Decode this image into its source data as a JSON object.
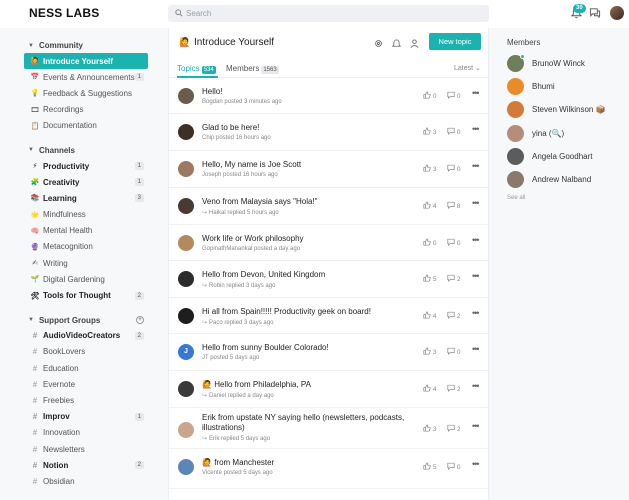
{
  "brand": "NESS LABS",
  "search": {
    "placeholder": "Search"
  },
  "header": {
    "notification_count": "30"
  },
  "sidebar": {
    "sections": [
      {
        "title": "Community",
        "items": [
          {
            "label": "Introduce Yourself",
            "icon": "🙋",
            "active": true,
            "bold": true,
            "count": ""
          },
          {
            "label": "Events & Announcements",
            "icon": "📅",
            "bold": false,
            "count": "1"
          },
          {
            "label": "Feedback & Suggestions",
            "icon": "💡",
            "bold": false,
            "count": ""
          },
          {
            "label": "Recordings",
            "icon": "🎞",
            "bold": false,
            "count": ""
          },
          {
            "label": "Documentation",
            "icon": "📋",
            "bold": false,
            "count": ""
          }
        ]
      },
      {
        "title": "Channels",
        "items": [
          {
            "label": "Productivity",
            "icon": "⚡",
            "bold": true,
            "count": "1"
          },
          {
            "label": "Creativity",
            "icon": "🧩",
            "bold": true,
            "count": "1"
          },
          {
            "label": "Learning",
            "icon": "📚",
            "bold": true,
            "count": "3"
          },
          {
            "label": "Mindfulness",
            "icon": "🌟",
            "bold": false,
            "count": ""
          },
          {
            "label": "Mental Health",
            "icon": "🧠",
            "bold": false,
            "count": ""
          },
          {
            "label": "Metacognition",
            "icon": "🔮",
            "bold": false,
            "count": ""
          },
          {
            "label": "Writing",
            "icon": "✍",
            "bold": false,
            "count": ""
          },
          {
            "label": "Digital Gardening",
            "icon": "🌱",
            "bold": false,
            "count": ""
          },
          {
            "label": "Tools for Thought",
            "icon": "🛠",
            "bold": true,
            "count": "2"
          }
        ]
      },
      {
        "title": "Support Groups",
        "items": [
          {
            "label": "AudioVideoCreators",
            "bold": true,
            "count": "2"
          },
          {
            "label": "BookLovers",
            "bold": false,
            "count": ""
          },
          {
            "label": "Education",
            "bold": false,
            "count": ""
          },
          {
            "label": "Evernote",
            "bold": false,
            "count": ""
          },
          {
            "label": "Freebies",
            "bold": false,
            "count": ""
          },
          {
            "label": "Improv",
            "bold": true,
            "count": "1"
          },
          {
            "label": "Innovation",
            "bold": false,
            "count": ""
          },
          {
            "label": "Newsletters",
            "bold": false,
            "count": ""
          },
          {
            "label": "Notion",
            "bold": true,
            "count": "2"
          },
          {
            "label": "Obsidian",
            "bold": false,
            "count": ""
          }
        ]
      }
    ]
  },
  "main": {
    "title": "Introduce Yourself",
    "new_topic_label": "New topic",
    "tabs": [
      {
        "label": "Topics",
        "count": "534",
        "active": true
      },
      {
        "label": "Members",
        "count": "1563",
        "active": false
      }
    ],
    "sort_label": "Latest",
    "topics": [
      {
        "title": "Hello!",
        "meta": "Bogdan posted 3 minutes ago",
        "reply": false,
        "likes": "0",
        "comments": "0",
        "avatar_color": "#6b5b4a",
        "prefix_icon": ""
      },
      {
        "title": "Glad to be here!",
        "meta": "Chip posted 16 hours ago",
        "reply": false,
        "likes": "3",
        "comments": "0",
        "avatar_color": "#3d2f23",
        "prefix_icon": ""
      },
      {
        "title": "Hello, My name is Joe Scott",
        "meta": "Joseph posted 16 hours ago",
        "reply": false,
        "likes": "3",
        "comments": "0",
        "avatar_color": "#9c7a62",
        "prefix_icon": ""
      },
      {
        "title": "Veno from Malaysia says \"Hola!\"",
        "meta": "Haikal replied 5 hours ago",
        "reply": true,
        "likes": "4",
        "comments": "8",
        "avatar_color": "#4a3a33",
        "prefix_icon": ""
      },
      {
        "title": "Work life or Work philosophy",
        "meta": "GopinathManankal posted a day ago",
        "reply": false,
        "likes": "0",
        "comments": "0",
        "avatar_color": "#b5895e",
        "prefix_icon": ""
      },
      {
        "title": "Hello from Devon, United Kingdom",
        "meta": "Robin replied 3 days ago",
        "reply": true,
        "likes": "5",
        "comments": "2",
        "avatar_color": "#2c2c2c",
        "prefix_icon": ""
      },
      {
        "title": "Hi all from Spain!!!!! Productivity geek on board!",
        "meta": "Paco replied 3 days ago",
        "reply": true,
        "likes": "4",
        "comments": "2",
        "avatar_color": "#1e1e1e",
        "prefix_icon": ""
      },
      {
        "title": "Hello from sunny Boulder Colorado!",
        "meta": "JT posted 5 days ago",
        "reply": false,
        "likes": "3",
        "comments": "0",
        "avatar_color": "#3a78d6",
        "avatar_letter": "J",
        "prefix_icon": ""
      },
      {
        "title": "Hello from Philadelphia, PA",
        "meta": "Daniel replied a day ago",
        "reply": true,
        "likes": "4",
        "comments": "2",
        "avatar_color": "#3a3a3a",
        "prefix_icon": "🙋"
      },
      {
        "title": "Erik from upstate NY saying hello (newsletters, podcasts, illustrations)",
        "meta": "Erik replied 5 days ago",
        "reply": true,
        "likes": "3",
        "comments": "2",
        "avatar_color": "#c9a58a",
        "prefix_icon": ""
      },
      {
        "title": "from Manchester",
        "meta": "Vicente posted 5 days ago",
        "reply": false,
        "likes": "5",
        "comments": "0",
        "avatar_color": "#5a86b8",
        "prefix_icon": "🙋"
      }
    ]
  },
  "members": {
    "title": "Members",
    "items": [
      {
        "name": "BrunoW Winck",
        "avatar_color": "#6e7d5a",
        "online": true
      },
      {
        "name": "Bhumi",
        "avatar_color": "#e88c2a",
        "online": false
      },
      {
        "name": "Steven Wilkinson 📦",
        "avatar_color": "#d37a3a",
        "online": false
      },
      {
        "name": "yina (🔍)",
        "avatar_color": "#b58e7a",
        "online": false
      },
      {
        "name": "Angela Goodhart",
        "avatar_color": "#5c5c5c",
        "online": false
      },
      {
        "name": "Andrew Nalband",
        "avatar_color": "#8a7a6a",
        "online": false
      }
    ],
    "see_all_label": "See all"
  }
}
